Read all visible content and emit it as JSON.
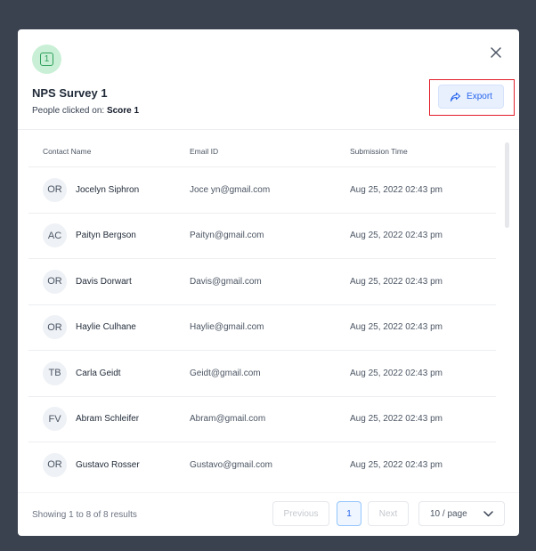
{
  "modal": {
    "badge_number": "1",
    "title": "NPS Survey 1",
    "subtitle_prefix": "People clicked on: ",
    "subtitle_value": "Score 1",
    "export_label": "Export"
  },
  "table": {
    "headers": {
      "name": "Contact Name",
      "email": "Email ID",
      "time": "Submission Time"
    },
    "rows": [
      {
        "initials": "OR",
        "name": "Jocelyn Siphron",
        "email": "Joce yn@gmail.com",
        "time": "Aug 25, 2022 02:43 pm"
      },
      {
        "initials": "AC",
        "name": "Paityn Bergson",
        "email": "Paityn@gmail.com",
        "time": "Aug 25, 2022 02:43 pm"
      },
      {
        "initials": "OR",
        "name": "Davis Dorwart",
        "email": "Davis@gmail.com",
        "time": "Aug 25, 2022 02:43 pm"
      },
      {
        "initials": "OR",
        "name": "Haylie Culhane",
        "email": "Haylie@gmail.com",
        "time": "Aug 25, 2022 02:43 pm"
      },
      {
        "initials": "TB",
        "name": "Carla Geidt",
        "email": "Geidt@gmail.com",
        "time": "Aug 25, 2022 02:43 pm"
      },
      {
        "initials": "FV",
        "name": "Abram Schleifer",
        "email": "Abram@gmail.com",
        "time": "Aug 25, 2022 02:43 pm"
      },
      {
        "initials": "OR",
        "name": "Gustavo Rosser",
        "email": "Gustavo@gmail.com",
        "time": "Aug 25, 2022 02:43 pm"
      }
    ]
  },
  "footer": {
    "showing_text": "Showing 1 to 8 of 8 results",
    "previous_label": "Previous",
    "current_page": "1",
    "next_label": "Next",
    "page_size": "10 / page"
  },
  "colors": {
    "backdrop": "#3a4250",
    "accent": "#2563eb",
    "badge_bg": "#c9f0d6",
    "badge_fg": "#2e9e5b",
    "highlight": "#e11d2a"
  },
  "icons": {
    "close": "close-icon",
    "export": "share-icon",
    "dropdown": "chevron-down-icon",
    "badge": "number-badge-icon"
  }
}
